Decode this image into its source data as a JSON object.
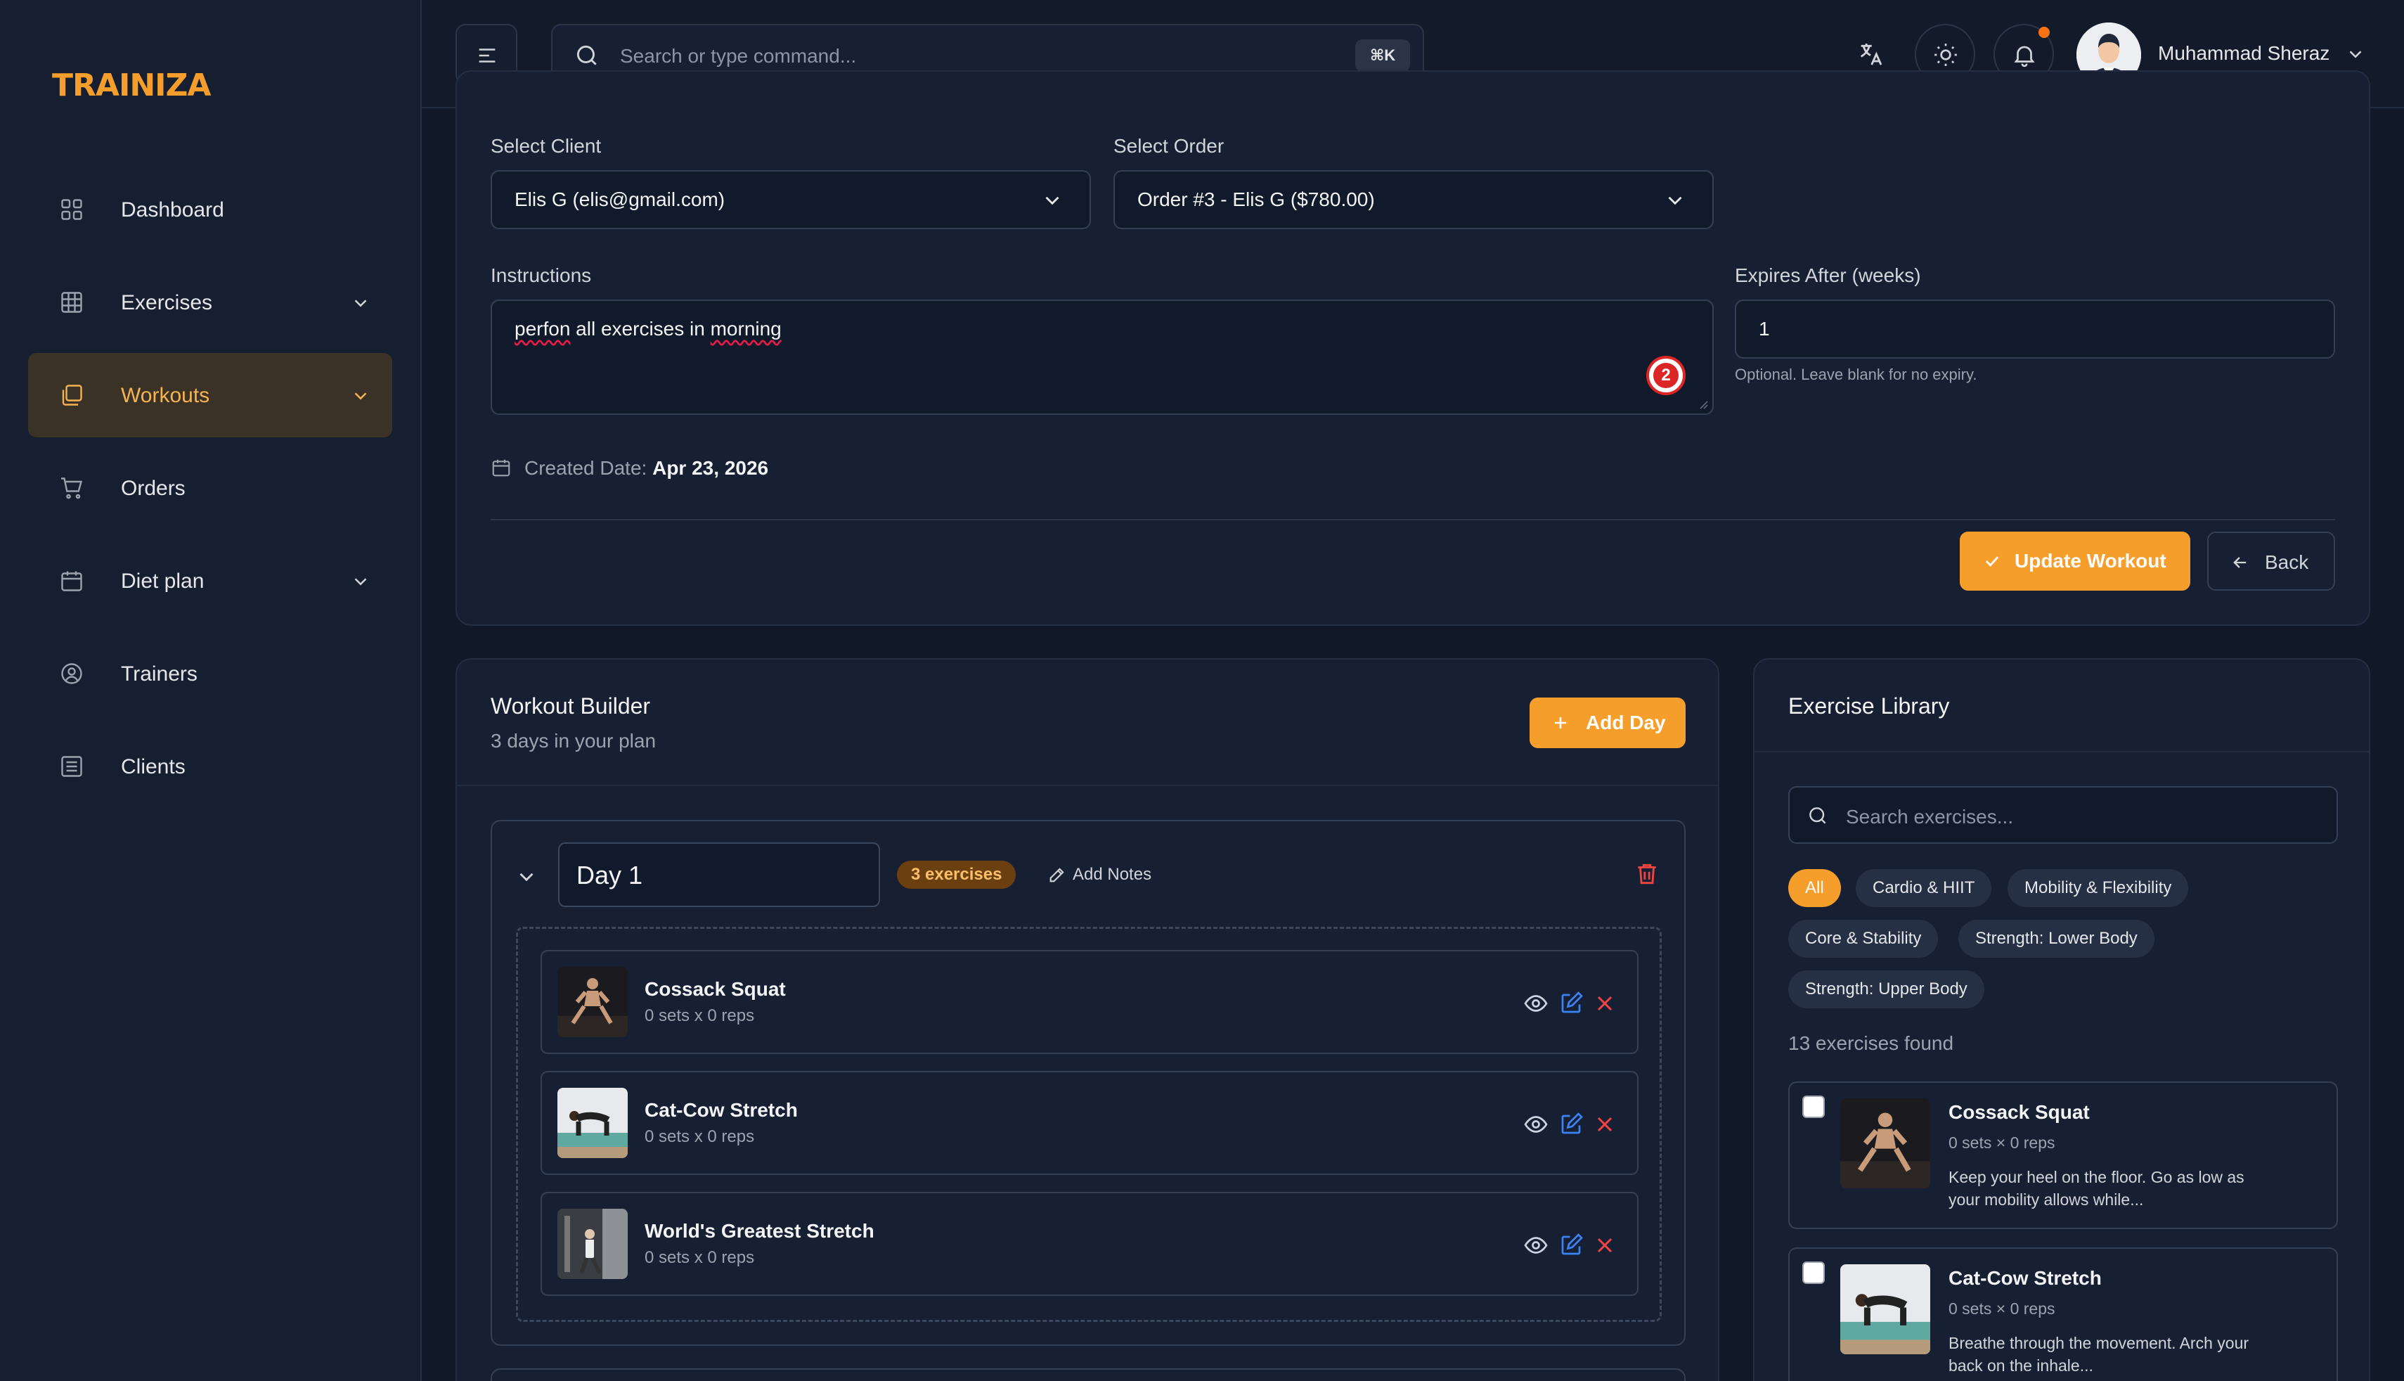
{
  "brand": {
    "logo": "TRAINIZA",
    "accent": "#f59e2b"
  },
  "sidebar": {
    "items": [
      {
        "label": "Dashboard",
        "icon": "grid-icon",
        "has_chevron": false,
        "active": false
      },
      {
        "label": "Exercises",
        "icon": "table-icon",
        "has_chevron": true,
        "active": false
      },
      {
        "label": "Workouts",
        "icon": "layers-icon",
        "has_chevron": true,
        "active": true
      },
      {
        "label": "Orders",
        "icon": "cart-icon",
        "has_chevron": false,
        "active": false
      },
      {
        "label": "Diet plan",
        "icon": "calendar-icon",
        "has_chevron": true,
        "active": false
      },
      {
        "label": "Trainers",
        "icon": "user-circle-icon",
        "has_chevron": false,
        "active": false
      },
      {
        "label": "Clients",
        "icon": "list-icon",
        "has_chevron": false,
        "active": false
      }
    ]
  },
  "topbar": {
    "search_placeholder": "Search or type command...",
    "shortcut": "⌘K",
    "user_name": "Muhammad Sheraz"
  },
  "form": {
    "client_label": "Select Client",
    "client_value": "Elis G (elis@gmail.com)",
    "order_label": "Select Order",
    "order_value": "Order #3 - Elis G ($780.00)",
    "instructions_label": "Instructions",
    "instructions_words": [
      "perfon",
      " all exercises in ",
      "morning"
    ],
    "grammar_count": "2",
    "expires_label": "Expires After (weeks)",
    "expires_value": "1",
    "expires_hint": "Optional. Leave blank for no expiry.",
    "created_label": "Created Date:",
    "created_value": "Apr 23, 2026",
    "update_button": "Update Workout",
    "back_button": "Back"
  },
  "builder": {
    "title": "Workout Builder",
    "subtitle": "3 days in your plan",
    "add_day": "Add Day",
    "day": {
      "name": "Day 1",
      "count_badge": "3 exercises",
      "add_notes": "Add Notes",
      "exercises": [
        {
          "name": "Cossack Squat",
          "meta": "0 sets x 0 reps"
        },
        {
          "name": "Cat-Cow Stretch",
          "meta": "0 sets x 0 reps"
        },
        {
          "name": "World's Greatest Stretch",
          "meta": "0 sets x 0 reps"
        }
      ]
    }
  },
  "library": {
    "title": "Exercise Library",
    "search_placeholder": "Search exercises...",
    "filters": [
      "All",
      "Cardio & HIIT",
      "Mobility & Flexibility",
      "Core & Stability",
      "Strength: Lower Body",
      "Strength: Upper Body"
    ],
    "active_filter": "All",
    "found_text": "13 exercises found",
    "items": [
      {
        "name": "Cossack Squat",
        "meta": "0 sets × 0 reps",
        "desc": "Keep your heel on the floor. Go as low as your mobility allows while..."
      },
      {
        "name": "Cat-Cow Stretch",
        "meta": "0 sets × 0 reps",
        "desc": "Breathe through the movement. Arch your back on the inhale..."
      }
    ]
  }
}
